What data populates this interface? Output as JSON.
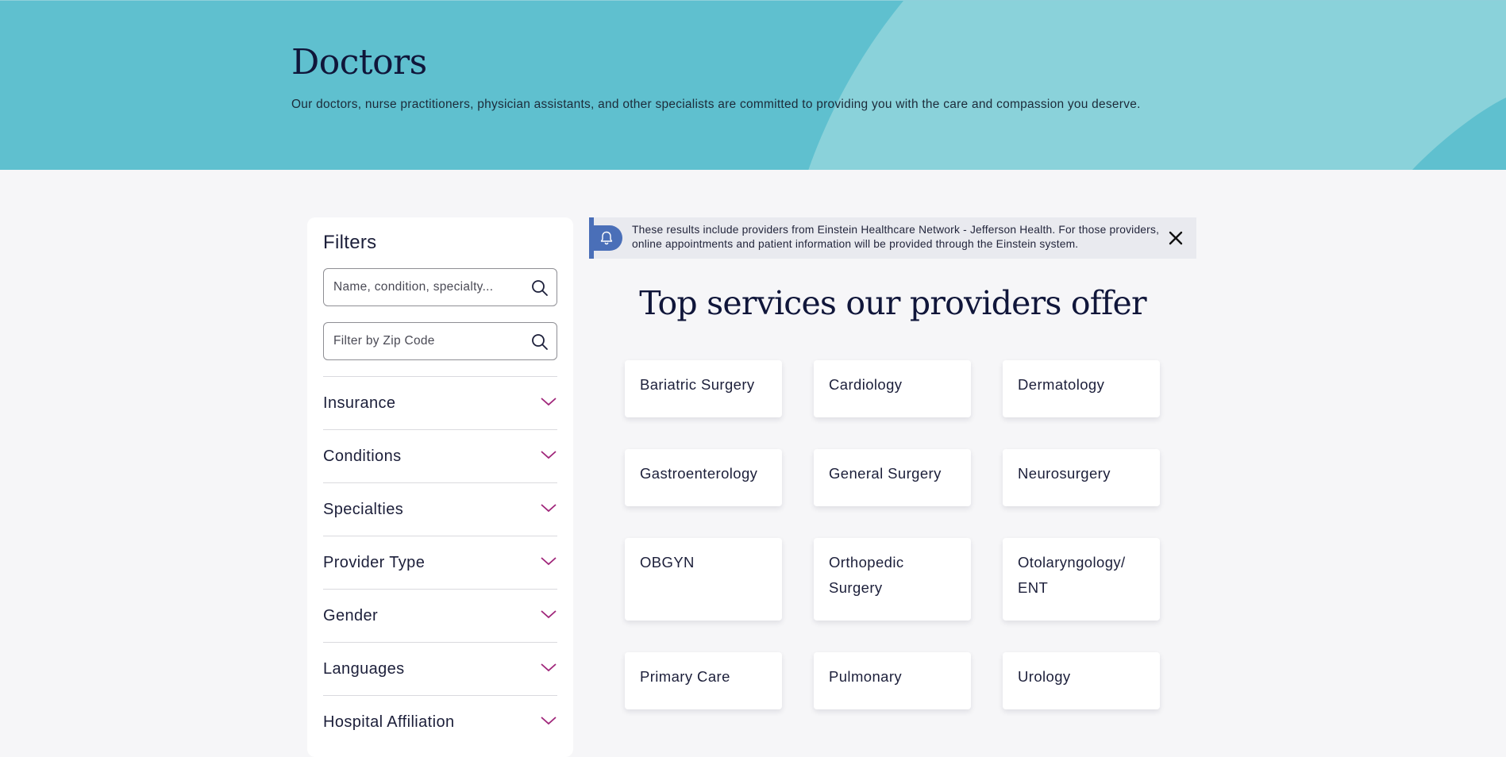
{
  "hero": {
    "title": "Doctors",
    "subtitle": "Our doctors, nurse practitioners, physician assistants, and other specialists are committed to providing you with the care and compassion you deserve."
  },
  "filters": {
    "title": "Filters",
    "search_placeholder": "Name, condition, specialty...",
    "zip_placeholder": "Filter by Zip Code",
    "sections": [
      {
        "label": "Insurance"
      },
      {
        "label": "Conditions"
      },
      {
        "label": "Specialties"
      },
      {
        "label": "Provider Type"
      },
      {
        "label": "Gender"
      },
      {
        "label": "Languages"
      },
      {
        "label": "Hospital Affiliation"
      }
    ]
  },
  "notice": {
    "message": "These results include providers from Einstein Healthcare Network - Jefferson Health. For those providers, online appointments and patient information will be provided through the Einstein system."
  },
  "services": {
    "title": "Top services our providers offer",
    "items": [
      {
        "label": "Bariatric Surgery"
      },
      {
        "label": "Cardiology"
      },
      {
        "label": "Dermatology"
      },
      {
        "label": "Gastroenterology"
      },
      {
        "label": "General Surgery"
      },
      {
        "label": "Neurosurgery"
      },
      {
        "label": "OBGYN"
      },
      {
        "label": "Orthopedic Surgery"
      },
      {
        "label": "Otolaryngology/ ENT"
      },
      {
        "label": "Primary Care"
      },
      {
        "label": "Pulmonary"
      },
      {
        "label": "Urology"
      }
    ]
  },
  "colors": {
    "hero_bg": "#5fc0cf",
    "hero_light": "#8ad2da",
    "accent": "#a0267a",
    "notice_bar": "#4a6fb8",
    "page_bg": "#f6f6f8"
  },
  "icons": {
    "search": "search-icon",
    "chevron": "chevron-down-icon",
    "bell": "bell-icon",
    "close": "close-icon"
  }
}
